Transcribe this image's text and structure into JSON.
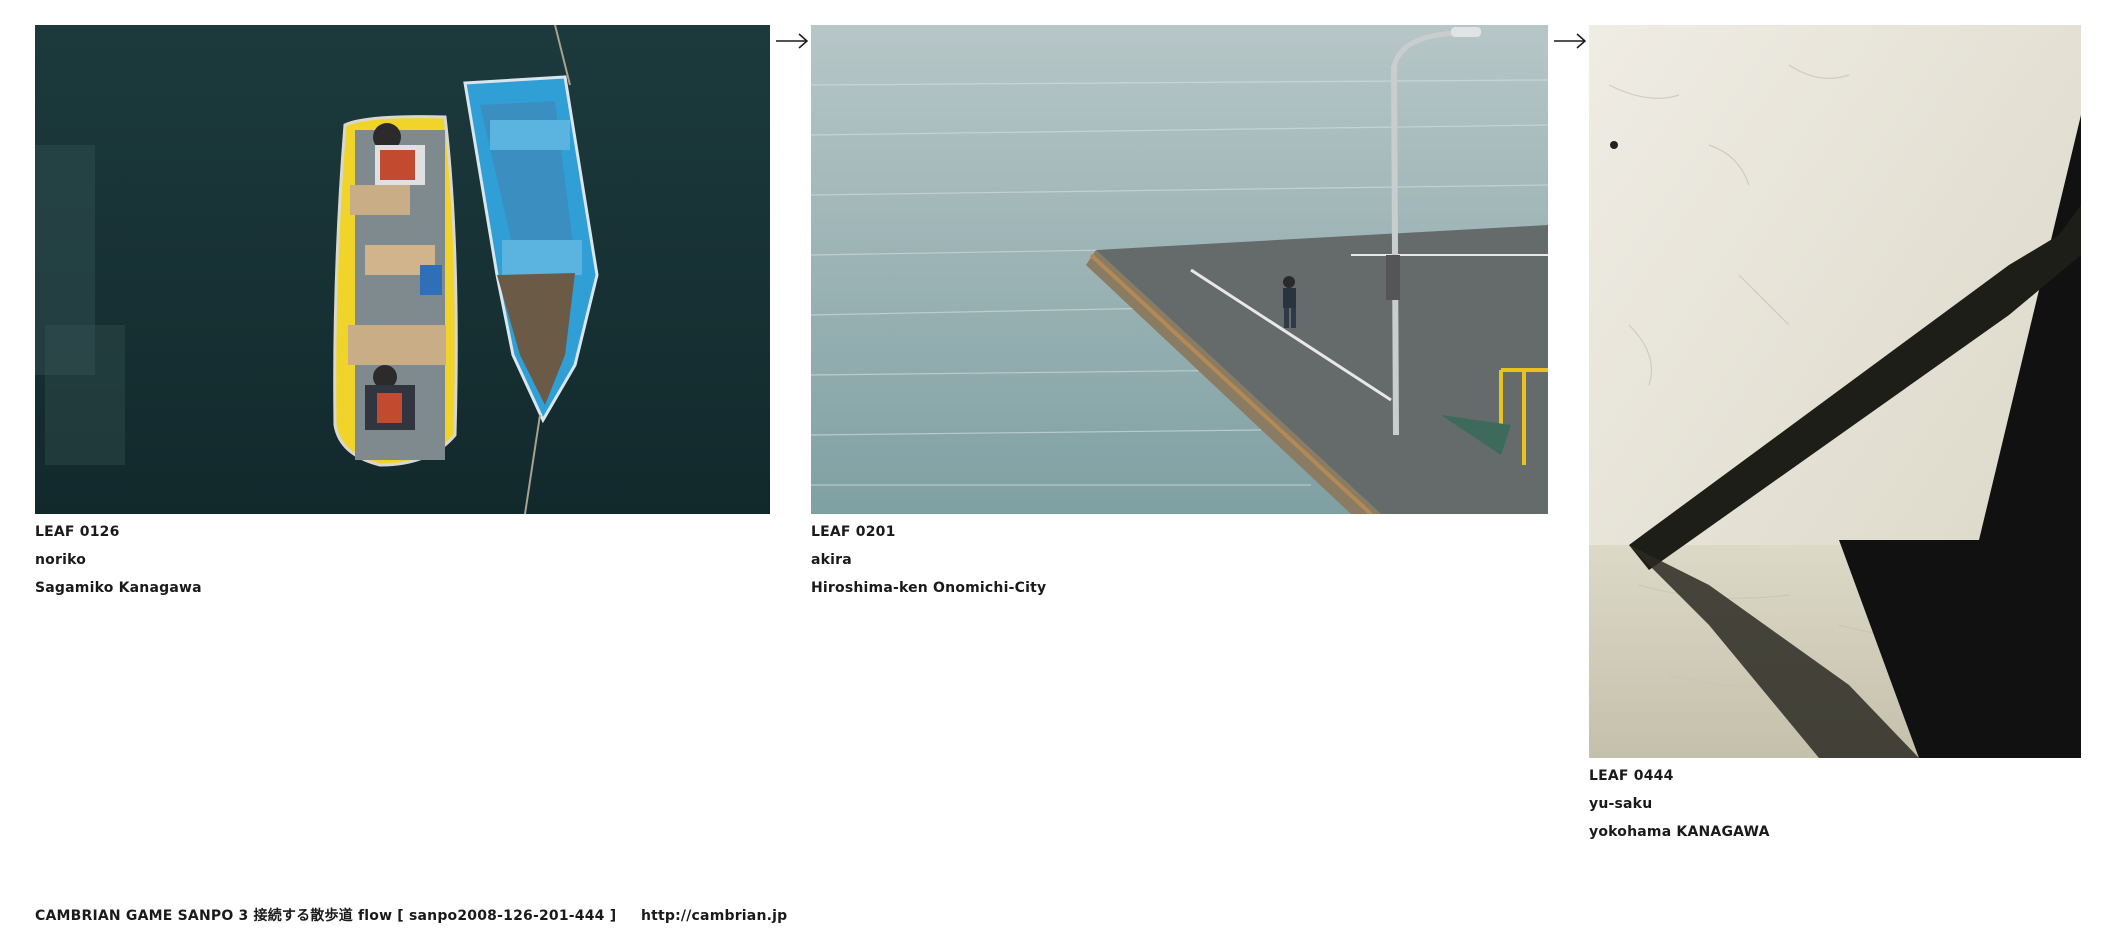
{
  "leaves": [
    {
      "title": "LEAF 0126",
      "author": "noriko",
      "location": "Sagamiko Kanagawa",
      "image": "photo of two rowboats (yellow and blue) with fishermen on dark water"
    },
    {
      "title": "LEAF 0201",
      "author": "akira",
      "location": "Hiroshima-ken Onomichi-City",
      "image": "photo of a boy standing on a concrete pier beside a street lamp over rippling water"
    },
    {
      "title": "LEAF 0444",
      "author": "yu-saku",
      "location": "yokohama  KANAGAWA",
      "image": "photo of a diagonal railing shadow on a textured white plaster wall"
    }
  ],
  "arrows": [
    "arrow-right-icon",
    "arrow-right-icon"
  ],
  "footer": {
    "text": "CAMBRIAN GAME  SANPO 3 接続する散歩道 flow [ sanpo2008-126-201-444 ]",
    "link": "http://cambrian.jp"
  },
  "colors": {
    "background": "#ffffff",
    "text": "#1a1a1a"
  }
}
